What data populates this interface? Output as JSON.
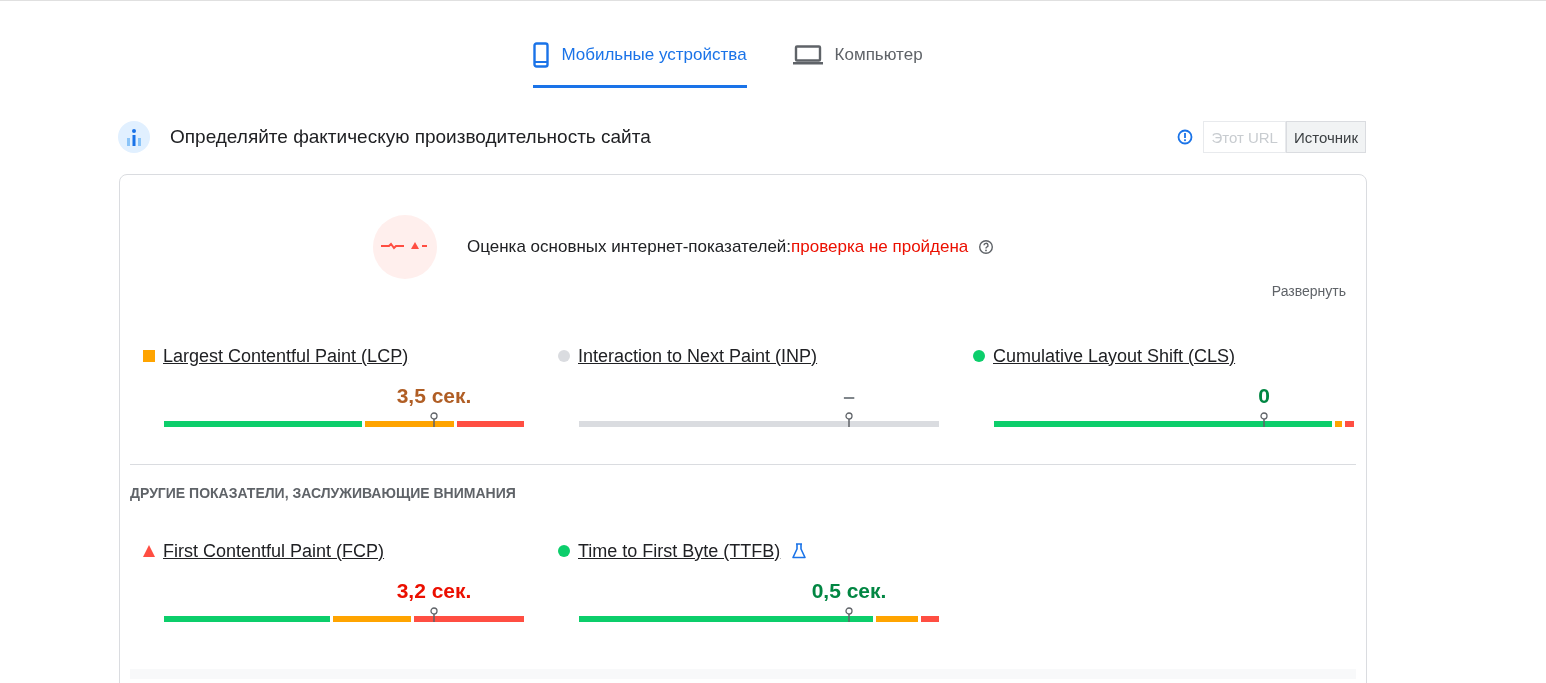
{
  "tabs": [
    {
      "label": "Мобильные устройства",
      "kind": "phone",
      "selected": true
    },
    {
      "label": "Компьютер",
      "kind": "laptop",
      "selected": false
    }
  ],
  "field_header": {
    "title": "Определяйте фактическую производительность сайта",
    "sources": [
      {
        "label": "Этот URL",
        "selected": false
      },
      {
        "label": "Источник",
        "selected": true
      }
    ]
  },
  "assessment": {
    "label": "Оценка основных интернет-показателей:",
    "result": "проверка не пройдена",
    "expand": "Развернуть"
  },
  "core_metrics": [
    {
      "name": "Largest Contentful Paint (LCP)",
      "kind": "average",
      "value": "3,5 сек."
    },
    {
      "name": "Interaction to Next Paint (INP)",
      "kind": "none",
      "value": "–"
    },
    {
      "name": "Cumulative Layout Shift (CLS)",
      "kind": "good",
      "value": "0"
    }
  ],
  "other_title": "ДРУГИЕ ПОКАЗАТЕЛИ, ЗАСЛУЖИВАЮЩИЕ ВНИМАНИЯ",
  "other_metrics": [
    {
      "name": "First Contentful Paint (FCP)",
      "kind": "poor",
      "value": "3,2 сек.",
      "experimental": false
    },
    {
      "name": "Time to First Byte (TTFB)",
      "kind": "good",
      "value": "0,5 сек.",
      "experimental": true
    }
  ]
}
